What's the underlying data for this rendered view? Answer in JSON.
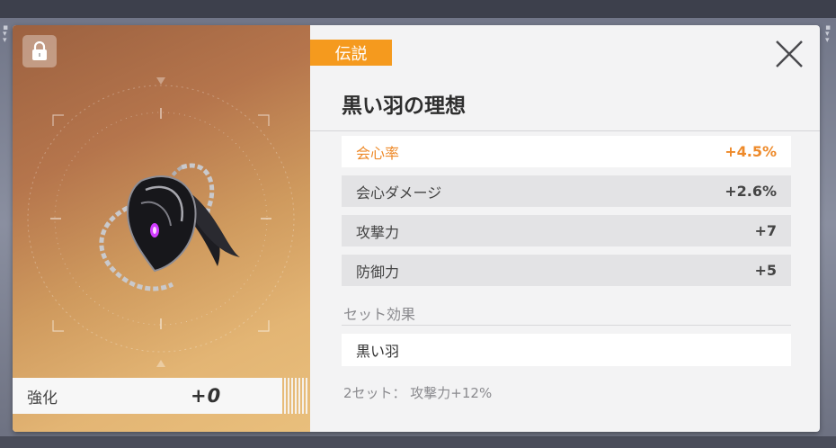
{
  "item": {
    "rarity": "伝説",
    "name": "黒い羽の理想",
    "enhance_label": "強化",
    "enhance_value": "+0"
  },
  "stats": [
    {
      "label": "会心率",
      "value": "+4.5%"
    },
    {
      "label": "会心ダメージ",
      "value": "+2.6%"
    },
    {
      "label": "攻撃力",
      "value": "+7"
    },
    {
      "label": "防御力",
      "value": "+5"
    }
  ],
  "set": {
    "title": "セット効果",
    "name": "黒い羽",
    "effect": "2セット： 攻撃力+12%"
  },
  "icons": {
    "lock": "lock-icon",
    "close": "close-icon",
    "item": "black-feather-necklace-icon"
  },
  "colors": {
    "rarity": "#f59a1e",
    "highlight_stat": "#ee8a2a",
    "card_bg": "#f3f3f4"
  }
}
